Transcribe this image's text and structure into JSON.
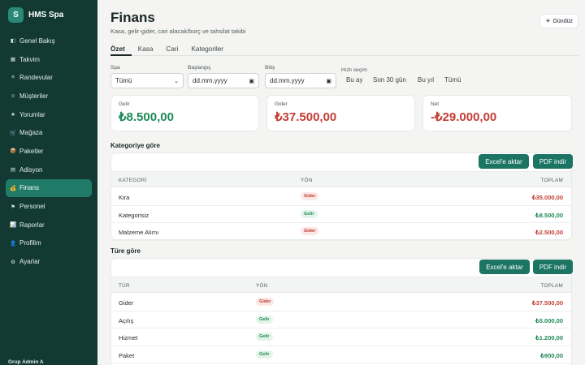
{
  "brand": {
    "logo_letter": "S",
    "name": "HMS Spa"
  },
  "sidebar": {
    "items": [
      {
        "label": "Genel Bakış",
        "icon": "◧"
      },
      {
        "label": "Takvim",
        "icon": "▦"
      },
      {
        "label": "Randevular",
        "icon": "≡"
      },
      {
        "label": "Müşteriler",
        "icon": "☺"
      },
      {
        "label": "Yorumlar",
        "icon": "★"
      },
      {
        "label": "Mağaza",
        "icon": "🛒"
      },
      {
        "label": "Paketler",
        "icon": "📦"
      },
      {
        "label": "Adisyon",
        "icon": "▤"
      },
      {
        "label": "Finans",
        "icon": "💰"
      },
      {
        "label": "Personel",
        "icon": "⚑"
      },
      {
        "label": "Raporlar",
        "icon": "📊"
      },
      {
        "label": "Profilim",
        "icon": "👤"
      },
      {
        "label": "Ayarlar",
        "icon": "⚙"
      }
    ],
    "active_index": 8,
    "footer": "Grup Admin A"
  },
  "header": {
    "title": "Finans",
    "subtitle": "Kasa, gelir-gider, cari alacak/borç ve tahsilat takibi",
    "theme_icon": "☀",
    "theme_label": "Gündüz"
  },
  "tabs": [
    "Özet",
    "Kasa",
    "Cari",
    "Kategoriler"
  ],
  "filters": {
    "spa_label": "Spa",
    "spa_value": "Tümü",
    "start_label": "Başlangıç",
    "start_value": "dd.mm.yyyy",
    "end_label": "Bitiş",
    "end_value": "dd.mm.yyyy",
    "quick_label": "Hızlı seçim",
    "quick": [
      "Bu ay",
      "Son 30 gün",
      "Bu yıl",
      "Tümü"
    ]
  },
  "kpis": [
    {
      "label": "Gelir",
      "value": "₺8.500,00",
      "tone": "green"
    },
    {
      "label": "Gider",
      "value": "₺37.500,00",
      "tone": "red"
    },
    {
      "label": "Net",
      "value": "-₺29.000,00",
      "tone": "red"
    }
  ],
  "category_section": {
    "title": "Kategoriye göre",
    "excel_label": "Excel'e aktar",
    "pdf_label": "PDF indir",
    "columns": [
      "KATEGORİ",
      "YÖN",
      "TOPLAM"
    ],
    "rows": [
      {
        "name": "Kira",
        "dir": "Gider",
        "total": "₺35.000,00"
      },
      {
        "name": "Kategorisiz",
        "dir": "Gelir",
        "total": "₺8.500,00"
      },
      {
        "name": "Malzeme Alımı",
        "dir": "Gider",
        "total": "₺2.500,00"
      }
    ]
  },
  "type_section": {
    "title": "Türe göre",
    "excel_label": "Excel'e aktar",
    "pdf_label": "PDF indir",
    "columns": [
      "TÜR",
      "YÖN",
      "TOPLAM"
    ],
    "rows": [
      {
        "name": "Gider",
        "dir": "Gider",
        "total": "₺37.500,00"
      },
      {
        "name": "Açılış",
        "dir": "Gelir",
        "total": "₺5.000,00"
      },
      {
        "name": "Hizmet",
        "dir": "Gelir",
        "total": "₺1.200,00"
      },
      {
        "name": "Paket",
        "dir": "Gelir",
        "total": "₺900,00"
      }
    ]
  },
  "colors": {
    "sidebar_bg": "#123a33",
    "accent": "#1c7563",
    "income": "#1f8a55",
    "expense": "#c43e35"
  }
}
